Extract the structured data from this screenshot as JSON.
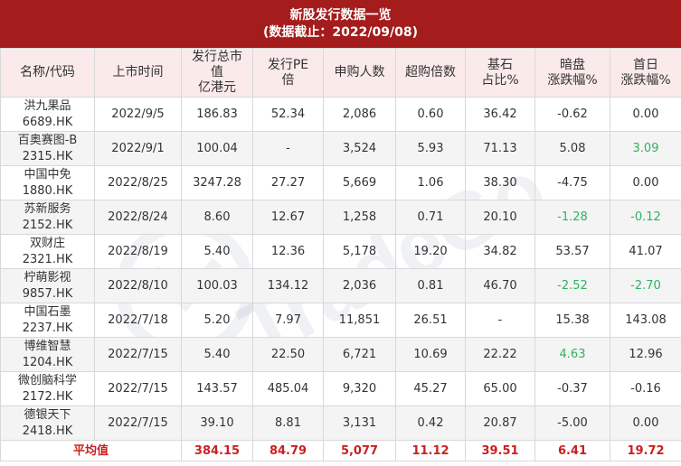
{
  "title": {
    "line1": "新股发行数据一览",
    "line2": "(数据截止：2022/09/08)"
  },
  "watermark": "TradeGo",
  "colors": {
    "header": "#a51c1c",
    "negative": "#2bb45f",
    "average": "#c9211e"
  },
  "columns": [
    {
      "lines": [
        "名称/代码"
      ]
    },
    {
      "lines": [
        "上市时间"
      ]
    },
    {
      "lines": [
        "发行总市",
        "值",
        "亿港元"
      ]
    },
    {
      "lines": [
        "发行PE",
        "倍"
      ]
    },
    {
      "lines": [
        "申购人数"
      ]
    },
    {
      "lines": [
        "超购倍数"
      ]
    },
    {
      "lines": [
        "基石",
        "占比%"
      ]
    },
    {
      "lines": [
        "暗盘",
        "涨跌幅%"
      ]
    },
    {
      "lines": [
        "首日",
        "涨跌幅%"
      ]
    }
  ],
  "rows": [
    {
      "name": "洪九果品",
      "code": "6689.HK",
      "date": "2022/9/5",
      "mcap": "186.83",
      "pe": "52.34",
      "subs": "2,086",
      "over": "0.60",
      "corner": "36.42",
      "grey": "-0.62",
      "grey_neg": false,
      "first": "0.00",
      "first_neg": false
    },
    {
      "name": "百奥赛图-B",
      "code": "2315.HK",
      "date": "2022/9/1",
      "mcap": "100.04",
      "pe": "-",
      "subs": "3,524",
      "over": "5.93",
      "corner": "71.13",
      "grey": "5.08",
      "grey_neg": false,
      "first": "3.09",
      "first_neg": true
    },
    {
      "name": "中国中免",
      "code": "1880.HK",
      "date": "2022/8/25",
      "mcap": "3247.28",
      "pe": "27.27",
      "subs": "5,669",
      "over": "1.06",
      "corner": "38.30",
      "grey": "-4.75",
      "grey_neg": false,
      "first": "0.00",
      "first_neg": false
    },
    {
      "name": "苏新服务",
      "code": "2152.HK",
      "date": "2022/8/24",
      "mcap": "8.60",
      "pe": "12.67",
      "subs": "1,258",
      "over": "0.71",
      "corner": "20.10",
      "grey": "-1.28",
      "grey_neg": true,
      "first": "-0.12",
      "first_neg": true
    },
    {
      "name": "双财庄",
      "code": "2321.HK",
      "date": "2022/8/19",
      "mcap": "5.40",
      "pe": "12.36",
      "subs": "5,178",
      "over": "19.20",
      "corner": "34.82",
      "grey": "53.57",
      "grey_neg": false,
      "first": "41.07",
      "first_neg": false
    },
    {
      "name": "柠萌影视",
      "code": "9857.HK",
      "date": "2022/8/10",
      "mcap": "100.03",
      "pe": "134.12",
      "subs": "2,036",
      "over": "0.81",
      "corner": "46.70",
      "grey": "-2.52",
      "grey_neg": true,
      "first": "-2.70",
      "first_neg": true
    },
    {
      "name": "中国石墨",
      "code": "2237.HK",
      "date": "2022/7/18",
      "mcap": "5.20",
      "pe": "7.97",
      "subs": "11,851",
      "over": "26.51",
      "corner": "-",
      "grey": "15.38",
      "grey_neg": false,
      "first": "143.08",
      "first_neg": false
    },
    {
      "name": "博维智慧",
      "code": "1204.HK",
      "date": "2022/7/15",
      "mcap": "5.40",
      "pe": "22.50",
      "subs": "6,721",
      "over": "10.69",
      "corner": "22.22",
      "grey": "4.63",
      "grey_neg": true,
      "first": "12.96",
      "first_neg": false
    },
    {
      "name": "微创脑科学",
      "code": "2172.HK",
      "date": "2022/7/15",
      "mcap": "143.57",
      "pe": "485.04",
      "subs": "9,320",
      "over": "45.27",
      "corner": "65.00",
      "grey": "-0.37",
      "grey_neg": false,
      "first": "-0.16",
      "first_neg": false
    },
    {
      "name": "德银天下",
      "code": "2418.HK",
      "date": "2022/7/15",
      "mcap": "39.10",
      "pe": "8.81",
      "subs": "3,131",
      "over": "0.42",
      "corner": "20.87",
      "grey": "-5.00",
      "grey_neg": false,
      "first": "0.00",
      "first_neg": false
    }
  ],
  "average": {
    "label": "平均值",
    "mcap": "384.15",
    "pe": "84.79",
    "subs": "5,077",
    "over": "11.12",
    "corner": "39.51",
    "grey": "6.41",
    "first": "19.72"
  }
}
